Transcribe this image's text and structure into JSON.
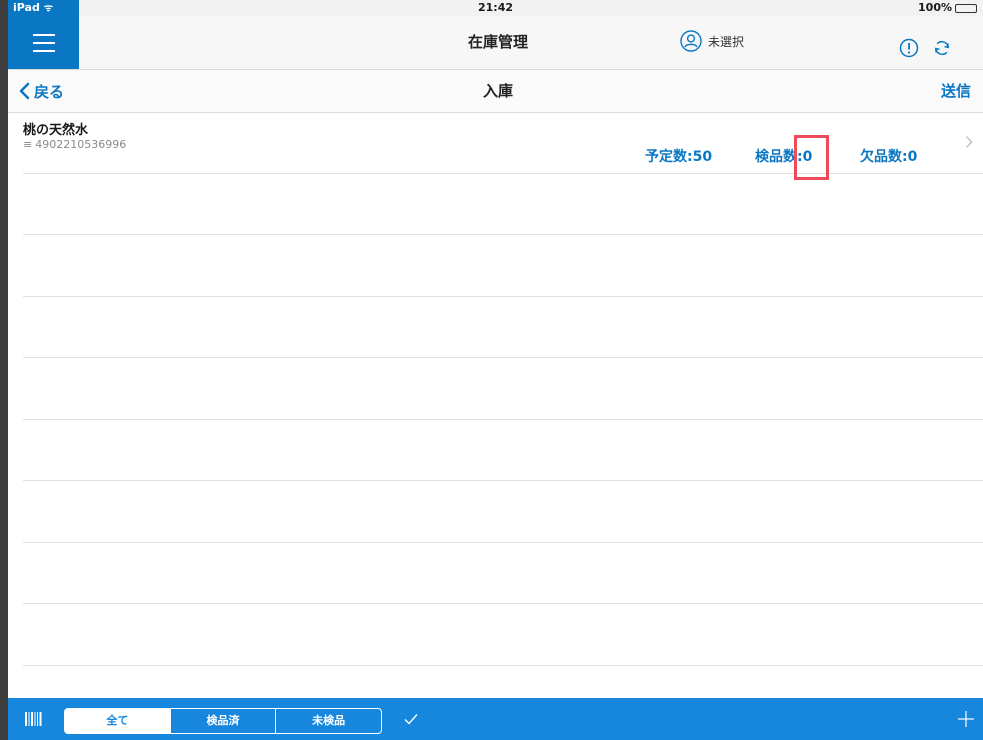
{
  "status_bar": {
    "carrier": "iPad",
    "time": "21:42",
    "battery": "100%"
  },
  "nav": {
    "title": "在庫管理",
    "user_label": "未選択",
    "icons": [
      "menu-icon",
      "user-icon",
      "alert-icon",
      "refresh-icon"
    ]
  },
  "sub_nav": {
    "back_label": "戻る",
    "title": "入庫",
    "send_label": "送信"
  },
  "items": [
    {
      "name": "桃の天然水",
      "code": "4902210536996",
      "planned": "予定数:50",
      "inspected": "検品数:0",
      "missing": "欠品数:0"
    }
  ],
  "toolbar": {
    "tabs": [
      "全て",
      "検品済",
      "未検品"
    ],
    "active_tab": "全て",
    "icons": [
      "barcode-icon",
      "check-icon",
      "plus-icon"
    ]
  },
  "colors": {
    "accent": "#0a77c4",
    "toolbar": "#1787dd",
    "highlight": "#ee4b5a"
  }
}
